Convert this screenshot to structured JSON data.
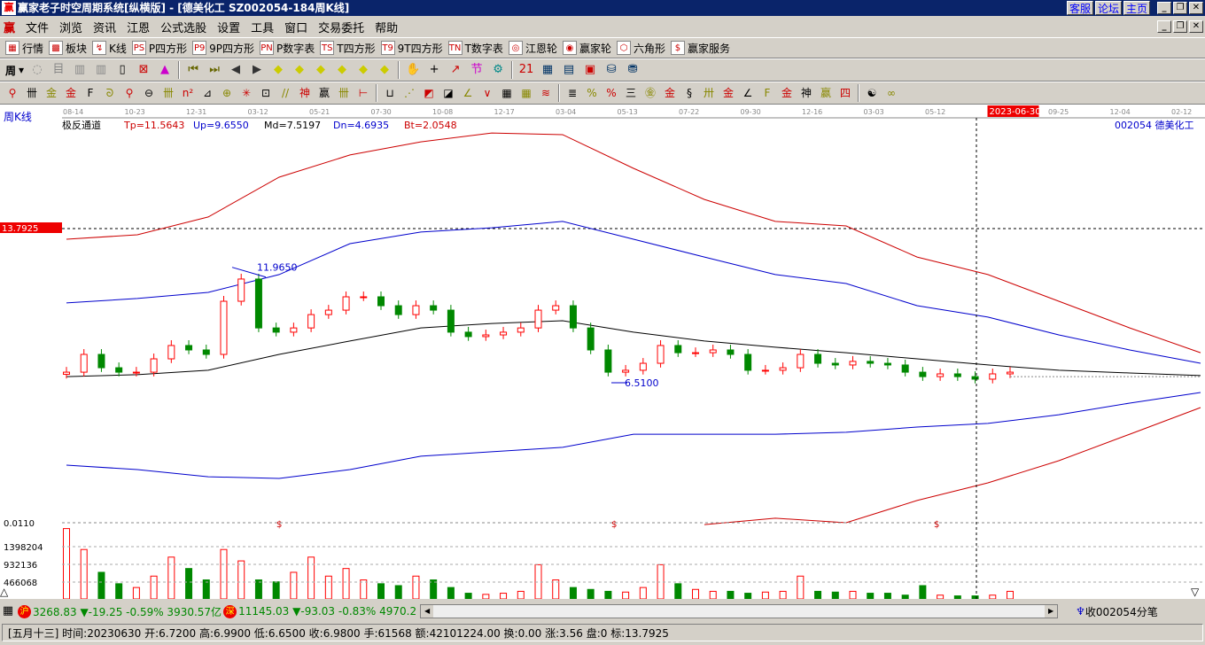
{
  "window": {
    "title": "赢家老子时空周期系统[纵横版] - [德美化工   SZ002054-184周K线]",
    "links": [
      "客服",
      "论坛",
      "主页"
    ],
    "logo": "赢"
  },
  "menu": [
    "文件",
    "浏览",
    "资讯",
    "江恩",
    "公式选股",
    "设置",
    "工具",
    "窗口",
    "交易委托",
    "帮助"
  ],
  "toolbar1": [
    {
      "icon": "grid-icon",
      "g": "▦",
      "label": "行情"
    },
    {
      "icon": "blocks-icon",
      "g": "▩",
      "label": "板块"
    },
    {
      "icon": "kline-icon",
      "g": "↯",
      "label": "K线"
    },
    {
      "icon": "ps-icon",
      "g": "PS",
      "label": "P四方形"
    },
    {
      "icon": "p9-icon",
      "g": "P9",
      "label": "9P四方形"
    },
    {
      "icon": "pn-icon",
      "g": "PN",
      "label": "P数字表"
    },
    {
      "icon": "ts-icon",
      "g": "TS",
      "label": "T四方形"
    },
    {
      "icon": "t9-icon",
      "g": "T9",
      "label": "9T四方形"
    },
    {
      "icon": "tn-icon",
      "g": "TN",
      "label": "T数字表"
    },
    {
      "icon": "gann-wheel-icon",
      "g": "◎",
      "label": "江恩轮"
    },
    {
      "icon": "winner-wheel-icon",
      "g": "◉",
      "label": "赢家轮"
    },
    {
      "icon": "hexagon-icon",
      "g": "⬡",
      "label": "六角形"
    },
    {
      "icon": "dollar-icon",
      "g": "$",
      "label": "赢家服务"
    }
  ],
  "toolbar2": {
    "period": "周",
    "icons": [
      "◌",
      "目",
      "▥",
      "▥",
      "▯",
      "⊠",
      "▲",
      "⏮",
      "⏭",
      "◀",
      "▶",
      "◆",
      "◆",
      "◆",
      "◆",
      "◆",
      "◆",
      "✋",
      "+",
      "↗",
      "节",
      "⚙",
      "21",
      "▦",
      "▤",
      "▣",
      "⛁",
      "⛃"
    ]
  },
  "toolbar3": [
    "⚲",
    "卌",
    "金",
    "金",
    "F",
    "ᘐ",
    "⚲",
    "⊖",
    "卌",
    "n²",
    "⊿",
    "⊕",
    "✳",
    "⊡",
    "//",
    "神",
    "赢",
    "卌",
    "⊢",
    "⊔",
    "⋰",
    "◩",
    "◪",
    "∠",
    "∨",
    "▦",
    "▦",
    "≋",
    "≣",
    "%",
    "%",
    "三",
    "㊎",
    "金",
    "§",
    "卅",
    "金",
    "∠",
    "F",
    "金",
    "神",
    "赢",
    "四",
    "☯",
    "∞"
  ],
  "chart": {
    "period_label": "周K线",
    "indicator": "极反通道",
    "tp": "Tp=11.5643",
    "up": "Up=9.6550",
    "md": "Md=7.5197",
    "dn": "Dn=4.6935",
    "bt": "Bt=2.0548",
    "stock": "002054  德美化工",
    "price_marker": "13.7925",
    "hi_label": "11.9650",
    "lo_label": "6.5100",
    "vol_marker": "0.0110",
    "cursor_date": "2023-06-30",
    "dollar": "$",
    "dates": [
      "08-14",
      "10-23",
      "12-31",
      "03-12",
      "05-21",
      "07-30",
      "10-08",
      "12-17",
      "03-04",
      "05-13",
      "07-22",
      "09-30",
      "12-16",
      "03-03",
      "05-12",
      "2023-06-30",
      "09-25",
      "12-04",
      "02-12"
    ],
    "vol_ticks": [
      "1398204",
      "932136",
      "466068"
    ],
    "colors": {
      "up": "#ff0000",
      "down": "#008000",
      "upper_outer": "#cc0000",
      "upper_inner": "#0000cc",
      "middle": "#000000"
    }
  },
  "chart_data": {
    "type": "candlestick",
    "ylim": [
      -0.1,
      18.8
    ],
    "closes": [
      7.01,
      7.85,
      7.22,
      7.01,
      7.01,
      7.64,
      8.27,
      8.06,
      7.85,
      10.36,
      11.41,
      9.1,
      8.9,
      9.1,
      9.73,
      9.94,
      10.57,
      10.57,
      10.15,
      9.73,
      10.15,
      9.94,
      8.9,
      8.69,
      8.77,
      8.9,
      9.1,
      9.94,
      10.15,
      9.1,
      8.06,
      7.01,
      7.1,
      7.43,
      8.27,
      7.93,
      7.93,
      8.06,
      7.85,
      7.1,
      7.1,
      7.22,
      7.85,
      7.43,
      7.35,
      7.52,
      7.43,
      7.35,
      7.01,
      6.8,
      6.93,
      6.8,
      6.68,
      6.93,
      7.01
    ],
    "volumes": [
      1850000,
      1300000,
      700000,
      400000,
      300000,
      600000,
      1100000,
      800000,
      500000,
      1300000,
      1000000,
      500000,
      450000,
      700000,
      1100000,
      600000,
      800000,
      500000,
      400000,
      350000,
      600000,
      500000,
      300000,
      150000,
      120000,
      150000,
      200000,
      900000,
      500000,
      300000,
      250000,
      200000,
      180000,
      300000,
      900000,
      400000,
      250000,
      200000,
      200000,
      150000,
      180000,
      200000,
      600000,
      200000,
      180000,
      200000,
      150000,
      150000,
      100000,
      350000,
      100000,
      80000,
      80000,
      100000,
      200000
    ],
    "bands": {
      "tp": [
        13.29,
        13.5,
        14.34,
        16.22,
        17.27,
        17.89,
        18.31,
        18.23,
        16.64,
        15.17,
        14.13,
        13.92,
        12.45,
        11.62,
        10.36,
        9.1,
        7.93
      ],
      "up": [
        10.28,
        10.49,
        10.78,
        11.62,
        13.08,
        13.63,
        13.83,
        14.13,
        13.29,
        12.45,
        11.62,
        11.2,
        10.15,
        9.61,
        8.77,
        8.06,
        7.43
      ],
      "md": [
        6.8,
        6.89,
        7.1,
        7.85,
        8.48,
        9.1,
        9.31,
        9.44,
        8.9,
        8.48,
        8.19,
        7.93,
        7.64,
        7.35,
        7.1,
        6.97,
        6.85
      ],
      "dn": [
        2.62,
        2.41,
        2.07,
        1.99,
        2.41,
        3.04,
        3.25,
        3.46,
        4.08,
        4.08,
        4.08,
        4.17,
        4.42,
        4.59,
        5.0,
        5.55,
        6.05
      ],
      "bt": [
        null,
        null,
        null,
        null,
        null,
        null,
        null,
        null,
        null,
        -0.19,
        0.11,
        -0.1,
        0.95,
        1.78,
        2.83,
        4.08,
        5.34
      ]
    }
  },
  "status1": {
    "sh_label": "沪",
    "sh": "3268.83 ▼-19.25 -0.59% 3930.57亿",
    "sz_label": "深",
    "sz": "11145.03 ▼-93.03 -0.83% 4970.2",
    "right": "收002054分笔"
  },
  "status2": "[五月十三] 时间:20230630 开:6.7200 高:6.9900 低:6.6500 收:6.9800 手:61568 额:42101224.00 换:0.00 涨:3.56 盘:0 标:13.7925"
}
